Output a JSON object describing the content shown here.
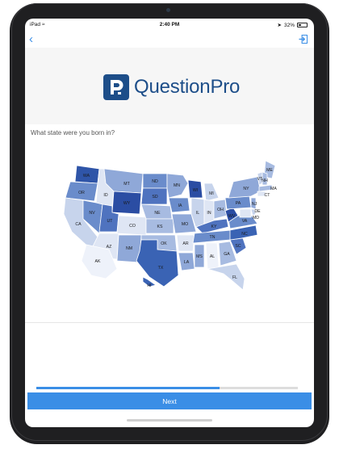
{
  "status": {
    "device": "iPad",
    "wifi": "wifi-icon",
    "time": "2:40 PM",
    "location": "location-icon",
    "battery": "32%",
    "battery_level": 0.32
  },
  "nav": {
    "back": "‹",
    "exit_icon": "exit-icon"
  },
  "logo": {
    "mark_letter": "P",
    "text": "QuestionPro",
    "color": "#1d4e89"
  },
  "question": {
    "text": "What state were you born in?"
  },
  "map": {
    "states": [
      {
        "code": "WA",
        "shade": "#2f55a8"
      },
      {
        "code": "OR",
        "shade": "#6a8ccb"
      },
      {
        "code": "CA",
        "shade": "#c7d4ec"
      },
      {
        "code": "ID",
        "shade": "#dfe6f4"
      },
      {
        "code": "NV",
        "shade": "#6a8ccb"
      },
      {
        "code": "MT",
        "shade": "#8fa8d8"
      },
      {
        "code": "WY",
        "shade": "#2b4da3"
      },
      {
        "code": "UT",
        "shade": "#4f73bf"
      },
      {
        "code": "AZ",
        "shade": "#dfe6f4"
      },
      {
        "code": "CO",
        "shade": "#dfe6f4"
      },
      {
        "code": "NM",
        "shade": "#8fa8d8"
      },
      {
        "code": "ND",
        "shade": "#6a8ccb"
      },
      {
        "code": "SD",
        "shade": "#4f73bf"
      },
      {
        "code": "NE",
        "shade": "#a7bbe1"
      },
      {
        "code": "KS",
        "shade": "#a7bbe1"
      },
      {
        "code": "OK",
        "shade": "#a7bbe1"
      },
      {
        "code": "TX",
        "shade": "#3a63b4"
      },
      {
        "code": "MN",
        "shade": "#8fa8d8"
      },
      {
        "code": "IA",
        "shade": "#6a8ccb"
      },
      {
        "code": "MO",
        "shade": "#8fa8d8"
      },
      {
        "code": "AR",
        "shade": "#dfe6f4"
      },
      {
        "code": "LA",
        "shade": "#8fa8d8"
      },
      {
        "code": "WI",
        "shade": "#2b4da3"
      },
      {
        "code": "IL",
        "shade": "#c7d4ec"
      },
      {
        "code": "MI",
        "shade": "#c7d4ec"
      },
      {
        "code": "IN",
        "shade": "#dfe6f4"
      },
      {
        "code": "OH",
        "shade": "#a7bbe1"
      },
      {
        "code": "KY",
        "shade": "#4f73bf"
      },
      {
        "code": "TN",
        "shade": "#6a8ccb"
      },
      {
        "code": "MS",
        "shade": "#8fa8d8"
      },
      {
        "code": "AL",
        "shade": "#eef2fa"
      },
      {
        "code": "GA",
        "shade": "#a7bbe1"
      },
      {
        "code": "FL",
        "shade": "#c7d4ec"
      },
      {
        "code": "SC",
        "shade": "#4f73bf"
      },
      {
        "code": "NC",
        "shade": "#3a63b4"
      },
      {
        "code": "VA",
        "shade": "#6a8ccb"
      },
      {
        "code": "WV",
        "shade": "#2b4da3"
      },
      {
        "code": "PA",
        "shade": "#6a8ccb"
      },
      {
        "code": "NY",
        "shade": "#8fa8d8"
      },
      {
        "code": "ME",
        "shade": "#a7bbe1"
      },
      {
        "code": "VT",
        "shade": "#c7d4ec"
      },
      {
        "code": "NH",
        "shade": "#a7bbe1"
      },
      {
        "code": "MA",
        "shade": "#a7bbe1"
      },
      {
        "code": "CT",
        "shade": "#dfe6f4"
      },
      {
        "code": "NJ",
        "shade": "#8fa8d8"
      },
      {
        "code": "DE",
        "shade": "#c7d4ec"
      },
      {
        "code": "MD",
        "shade": "#dfe6f4"
      },
      {
        "code": "AK",
        "shade": "#eef2fa"
      },
      {
        "code": "HI",
        "shade": "#3a63b4"
      }
    ]
  },
  "progress": {
    "fraction": 0.7
  },
  "next": {
    "label": "Next"
  },
  "colors": {
    "accent": "#3a8ee6",
    "brand": "#1d4e89"
  }
}
